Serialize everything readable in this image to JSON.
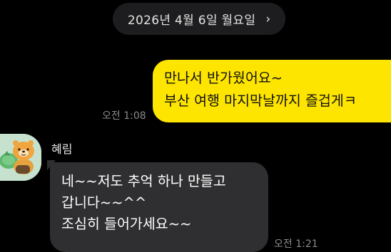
{
  "date_divider": {
    "text": "2026년 4월 6일 월요일",
    "chevron": "›"
  },
  "messages": [
    {
      "direction": "outgoing",
      "lines": [
        "만나서 반가웠어요~",
        "부산 여행 마지막날까지 즐겁게ㅋ"
      ],
      "time": "오전 1:08"
    },
    {
      "direction": "incoming",
      "sender": "혜림",
      "lines": [
        "네~~저도  추억 하나 만들고",
        "갑니다~~^^",
        "조심히 들어가세요~~"
      ],
      "time": "오전 1:21"
    }
  ],
  "colors": {
    "background": "#000000",
    "outgoing_bubble": "#fee500",
    "incoming_bubble": "#2f2f31",
    "date_pill": "#1d1d1f",
    "timestamp": "#8a8a8a"
  },
  "icons": {
    "date_chevron": "chevron-right-icon",
    "avatar": "bear-character-avatar"
  }
}
